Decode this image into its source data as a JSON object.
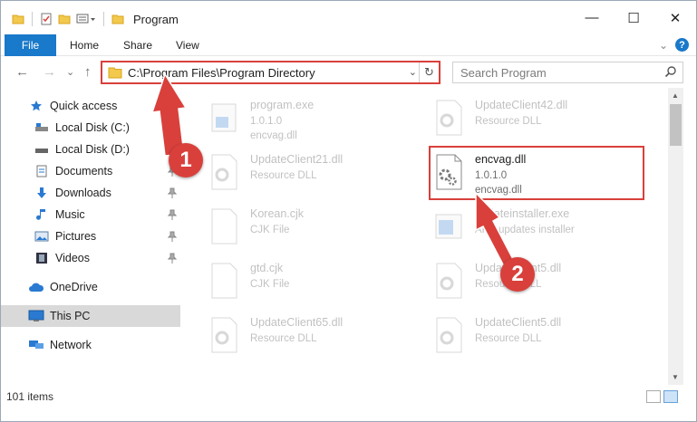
{
  "window": {
    "title": "Program",
    "controls": {
      "minimize": "—",
      "maximize": "☐",
      "close": "✕"
    }
  },
  "ribbon": {
    "tabs": [
      "File",
      "Home",
      "Share",
      "View"
    ],
    "expand_glyph": "⌄",
    "help_glyph": "?"
  },
  "nav": {
    "back_glyph": "←",
    "forward_glyph": "→",
    "recent_glyph": "⌄",
    "up_glyph": "↑",
    "address_path": "C:\\Program Files\\Program Directory",
    "address_dropdown_glyph": "⌄",
    "refresh_glyph": "↻",
    "search_placeholder": "Search Program"
  },
  "sidebar": {
    "items": [
      {
        "label": "Quick access",
        "icon": "star-icon",
        "pinned": false
      },
      {
        "label": "Local Disk (C:)",
        "icon": "drive-icon",
        "pinned": true
      },
      {
        "label": "Local Disk (D:)",
        "icon": "drive-icon",
        "pinned": true
      },
      {
        "label": "Documents",
        "icon": "documents-icon",
        "pinned": true
      },
      {
        "label": "Downloads",
        "icon": "download-arrow-icon",
        "pinned": true
      },
      {
        "label": "Music",
        "icon": "music-note-icon",
        "pinned": true
      },
      {
        "label": "Pictures",
        "icon": "pictures-icon",
        "pinned": true
      },
      {
        "label": "Videos",
        "icon": "film-icon",
        "pinned": true
      },
      {
        "label": "OneDrive",
        "icon": "cloud-icon",
        "pinned": false
      },
      {
        "label": "This PC",
        "icon": "monitor-icon",
        "pinned": false,
        "selected": true
      },
      {
        "label": "Network",
        "icon": "network-icon",
        "pinned": false
      }
    ]
  },
  "files": {
    "left_column": [
      {
        "name": "program.exe",
        "line2": "1.0.1.0",
        "line3": "encvag.dll",
        "icon": "exe-icon"
      },
      {
        "name": "UpdateClient21.dll",
        "line2": "Resource DLL",
        "line3": "",
        "icon": "dll-gear-icon"
      },
      {
        "name": "Korean.cjk",
        "line2": "CJK File",
        "line3": "",
        "icon": "blank-file-icon"
      },
      {
        "name": "gtd.cjk",
        "line2": "CJK File",
        "line3": "",
        "icon": "blank-file-icon"
      },
      {
        "name": "UpdateClient65.dll",
        "line2": "Resource DLL",
        "line3": "",
        "icon": "dll-gear-icon"
      }
    ],
    "right_column": [
      {
        "name": "UpdateClient42.dll",
        "line2": "Resource DLL",
        "line3": "",
        "icon": "dll-gear-icon"
      },
      {
        "name": "encvag.dll",
        "line2": "1.0.1.0",
        "line3": "encvag.dll",
        "icon": "dll-gear-icon",
        "active": true
      },
      {
        "name": "updateinstaller.exe",
        "line2": "APP updates installer",
        "line3": "",
        "icon": "installer-icon"
      },
      {
        "name": "UpdateClient5.dll",
        "line2": "Resource DLL",
        "line3": "",
        "icon": "dll-gear-icon"
      },
      {
        "name": "UpdateClient5.dll",
        "line2": "Resource DLL",
        "line3": "",
        "icon": "dll-gear-icon"
      }
    ]
  },
  "status": {
    "item_count": "101 items"
  },
  "annotations": {
    "marker1": "1",
    "marker2": "2"
  },
  "colors": {
    "accent": "#1979ca",
    "highlight": "#d9403b",
    "selected_bg": "#d9d9d9"
  }
}
